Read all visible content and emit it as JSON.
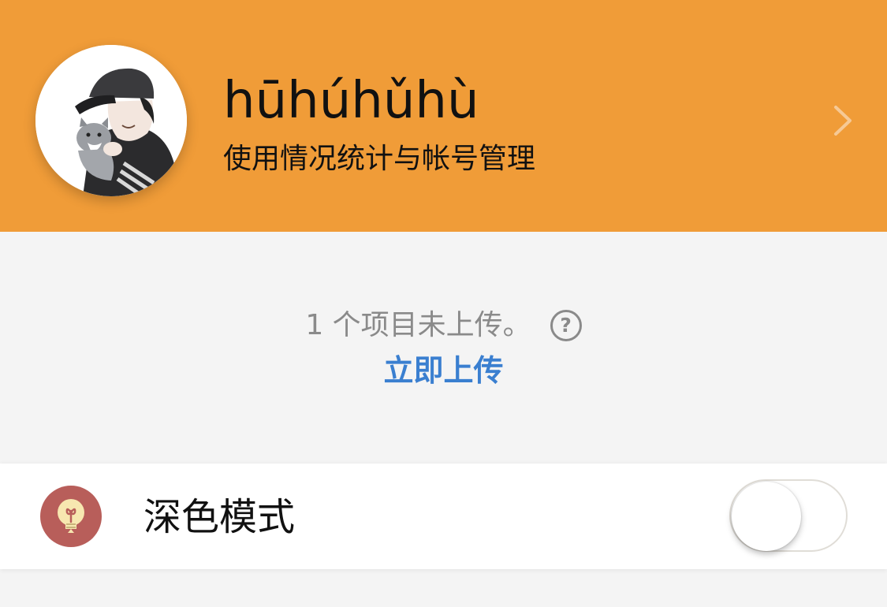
{
  "colors": {
    "header_bg": "#f09c38",
    "page_bg": "#f4f4f4",
    "link": "#3a7fd0",
    "muted_text": "#8a8a8a",
    "dark_mode_icon_bg": "#b85e5a"
  },
  "header": {
    "avatar_icon": "avatar",
    "user_name": "hūhúhǔhù",
    "subtitle": "使用情况统计与帐号管理",
    "chevron_icon": "chevron-right-icon"
  },
  "upload": {
    "message": "1 个项目未上传。",
    "help_icon_text": "?",
    "action": "立即上传"
  },
  "settings": {
    "dark_mode": {
      "icon": "lightbulb-icon",
      "label": "深色模式",
      "enabled": false
    }
  }
}
